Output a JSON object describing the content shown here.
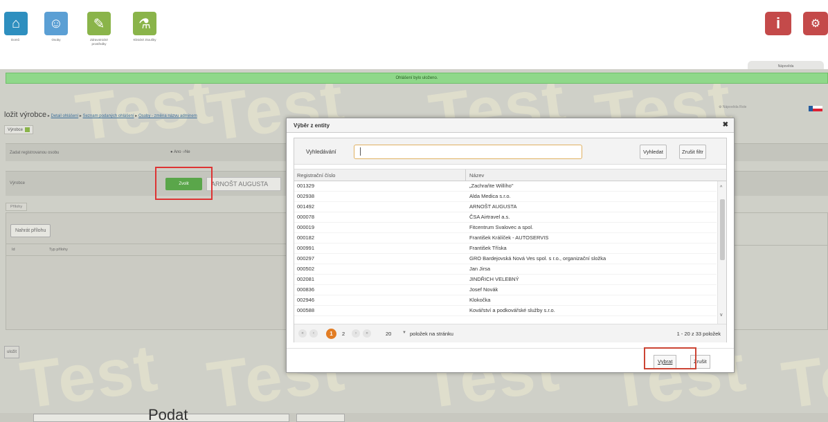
{
  "nav": {
    "home_label": "Domů",
    "persons_label": "Osoby",
    "products_label": "Zdravotnické prostředky",
    "clinical_label": "Klinické zkoušky",
    "help_tab": "Nápověda"
  },
  "notice": "Ohlášení bylo uloženo.",
  "breadcrumb": {
    "title": "ložit výrobce",
    "crumbs": [
      "Detail ohlášení",
      "Seznam podaných ohlášení",
      "Osoby - změna názvu adminem"
    ],
    "separator": "▸"
  },
  "help_link": "Nápověda Role",
  "manufacturer_tab": "Výrobce",
  "form": {
    "register_label": "Zadat registrovanou osobu",
    "radio_yes": "Ano",
    "radio_no": "Ne",
    "manufacturer_label": "Výrobce",
    "choose_button": "Zvolit",
    "manufacturer_value": "ARNOŠT AUGUSTA"
  },
  "attachments": {
    "tab": "Přílohy",
    "upload_button": "Nahrát přílohu",
    "col_id": "Id",
    "col_type": "Typ přílohy"
  },
  "save_button": "uložit",
  "bottom_text": "Podat",
  "watermark": "Test",
  "modal": {
    "title": "Výběr z entity",
    "close": "✖",
    "search_label": "Vyhledávání",
    "search_value": "",
    "search_button": "Vyhledat",
    "clear_filter_button": "Zrušit filtr",
    "col_reg": "Registrační číslo",
    "col_name": "Název",
    "rows": [
      {
        "reg": "001329",
        "name": "„Zachraňte Willího\""
      },
      {
        "reg": "002938",
        "name": "Alda Medica s.r.o."
      },
      {
        "reg": "001492",
        "name": "ARNOŠT AUGUSTA"
      },
      {
        "reg": "000078",
        "name": "ČSA Airtravel a.s."
      },
      {
        "reg": "000019",
        "name": "Fitcentrum Svalovec a spol."
      },
      {
        "reg": "000182",
        "name": "František Králíček - AUTOSERVIS"
      },
      {
        "reg": "000991",
        "name": "František Tříska"
      },
      {
        "reg": "000297",
        "name": "GRO Bardejovská Nová Ves spol. s r.o., organizační složka"
      },
      {
        "reg": "000502",
        "name": "Jan Jirsa"
      },
      {
        "reg": "002081",
        "name": "JINDŘICH VELEBNÝ"
      },
      {
        "reg": "000836",
        "name": "Josef Novák"
      },
      {
        "reg": "002946",
        "name": "Klokočka"
      },
      {
        "reg": "000588",
        "name": "Kovářství a podkovářské služby s.r.o."
      }
    ],
    "pager": {
      "first": "«",
      "prev": "‹",
      "current_page": "1",
      "next_page": "2",
      "next": "›",
      "last": "»",
      "page_size": "20",
      "per_page_label": "položek na stránku",
      "info": "1 - 20 z 33 položek"
    },
    "select_button": "Vybrat",
    "cancel_button": "Zrušit"
  }
}
